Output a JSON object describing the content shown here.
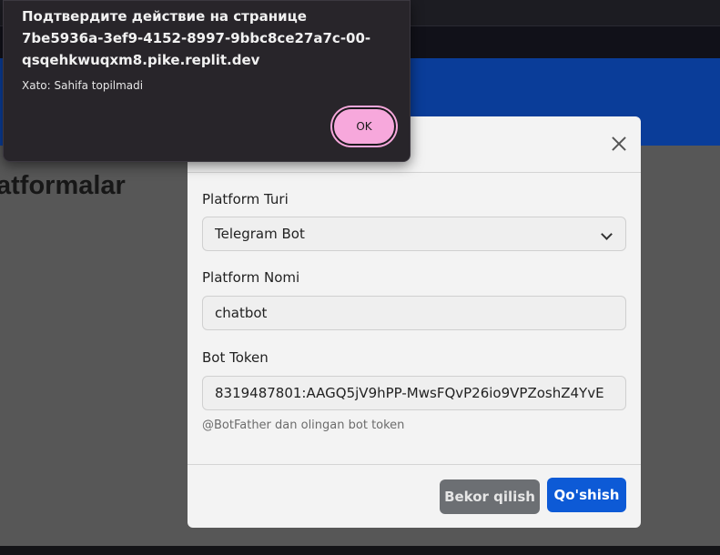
{
  "page": {
    "title": "atformalar"
  },
  "modal": {
    "platform_type": {
      "label": "Platform Turi",
      "selected": "Telegram Bot"
    },
    "platform_name": {
      "label": "Platform Nomi",
      "value": "chatbot"
    },
    "bot_token": {
      "label": "Bot Token",
      "value": "8319487801:AAGQ5jV9hPP-MwsFQvP26io9VPZoshZ4YvE",
      "help": "@BotFather dan olingan bot token"
    },
    "cancel_label": "Bekor qilish",
    "add_label": "Qo'shish"
  },
  "alert": {
    "title": "Подтвердите действие на странице 7be5936a-3ef9-4152-8997-9bbc8ce27a7c-00-qsqehkwuqxm8.pike.replit.dev",
    "message": "Xato: Sahifa topilmadi",
    "ok_label": "OK"
  },
  "colors": {
    "navbar": "#0a3d99",
    "overlay_page": "#575757",
    "modal_bg": "#f3f3f3",
    "primary_button": "#0d5ad6",
    "secondary_button": "#6c6f73",
    "alert_bg": "#28252a",
    "ok_button": "#f7a8dc"
  }
}
